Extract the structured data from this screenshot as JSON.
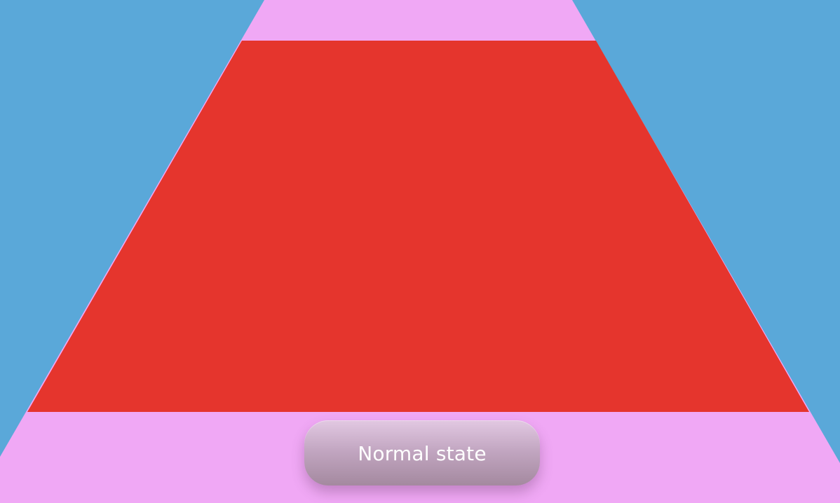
{
  "scene": {
    "colors": {
      "background": "#5aa8d9",
      "outer_trapezoid": "#f0a8f5",
      "inner_trapezoid": "#e5352d",
      "button_text": "#ffffff"
    }
  },
  "button": {
    "label": "Normal state"
  }
}
